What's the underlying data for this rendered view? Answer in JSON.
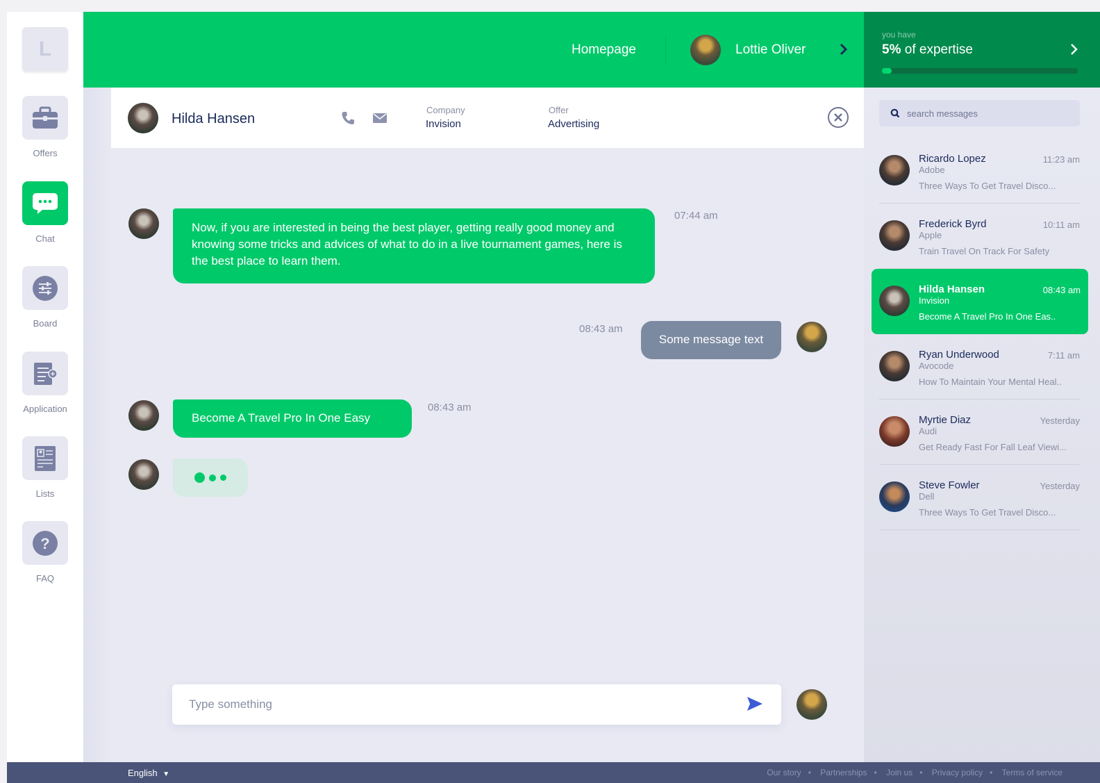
{
  "sidebar": {
    "logo_letter": "L",
    "items": [
      {
        "label": "Offers",
        "icon": "briefcase-icon",
        "active": false
      },
      {
        "label": "Chat",
        "icon": "chat-bubble-icon",
        "active": true
      },
      {
        "label": "Board",
        "icon": "sliders-icon",
        "active": false
      },
      {
        "label": "Application",
        "icon": "document-add-icon",
        "active": false
      },
      {
        "label": "Lists",
        "icon": "id-card-icon",
        "active": false
      },
      {
        "label": "FAQ",
        "icon": "question-icon",
        "active": false
      }
    ]
  },
  "header": {
    "homepage": "Homepage",
    "user_name": "Lottie Oliver"
  },
  "expertise": {
    "prefix": "you have",
    "percent": "5%",
    "suffix": "of expertise",
    "progress_fraction": 0.05
  },
  "chat_header": {
    "name": "Hilda Hansen",
    "company_label": "Company",
    "company": "Invision",
    "offer_label": "Offer",
    "offer": "Advertising"
  },
  "messages": [
    {
      "text": "Now, if you are interested in being the best player, getting really good money and knowing some tricks and advices of what to do in a live tournament games, here is the best place to learn them.",
      "time": "07:44 am",
      "from": "them"
    },
    {
      "text": "Some message text",
      "time": "08:43 am",
      "from": "me"
    },
    {
      "text": "Become A Travel Pro In One Easy",
      "time": "08:43 am",
      "from": "them"
    }
  ],
  "composer": {
    "placeholder": "Type something"
  },
  "search": {
    "placeholder": "search messages"
  },
  "conversations": [
    {
      "name": "Ricardo Lopez",
      "company": "Adobe",
      "time": "11:23 am",
      "preview": "Three Ways To Get Travel Disco...",
      "active": false
    },
    {
      "name": "Frederick Byrd",
      "company": "Apple",
      "time": "10:11 am",
      "preview": "Train Travel On Track For Safety",
      "active": false
    },
    {
      "name": "Hilda Hansen",
      "company": "Invision",
      "time": "08:43 am",
      "preview": "Become A Travel Pro In One Eas..",
      "active": true
    },
    {
      "name": "Ryan Underwood",
      "company": "Avocode",
      "time": "7:11 am",
      "preview": "How To Maintain Your Mental Heal..",
      "active": false
    },
    {
      "name": "Myrtie Diaz",
      "company": "Audi",
      "time": "Yesterday",
      "preview": "Get Ready Fast For Fall Leaf Viewi...",
      "active": false
    },
    {
      "name": "Steve Fowler",
      "company": "Dell",
      "time": "Yesterday",
      "preview": "Three Ways To Get Travel Disco...",
      "active": false
    }
  ],
  "footer": {
    "language": "English",
    "links": [
      "Our story",
      "Partnerships",
      "Join us",
      "Privacy policy",
      "Terms of service"
    ]
  },
  "colors": {
    "accent": "#00c96a",
    "accent_dark": "#008a4c",
    "sent_bubble": "#7b8aa1",
    "footer": "#4a5478"
  }
}
